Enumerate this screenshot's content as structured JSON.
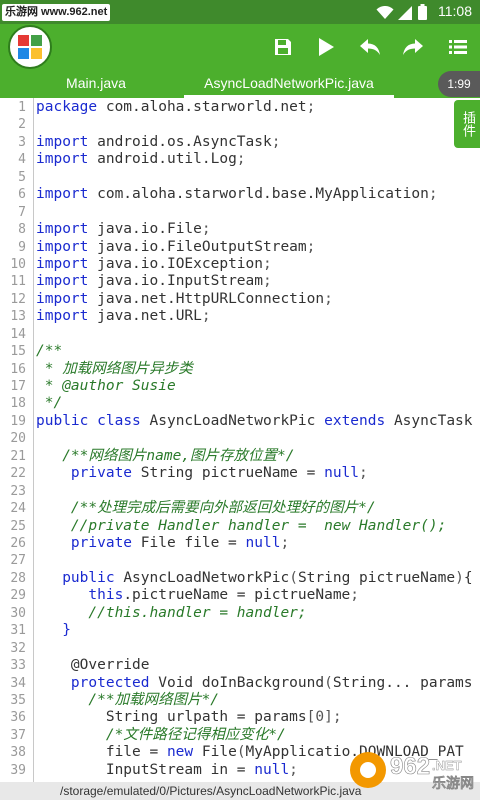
{
  "status_bar": {
    "watermark_text": "乐游网 www.962.net",
    "time": "11:08",
    "icons": [
      "wifi-icon",
      "signal-icon",
      "battery-icon"
    ]
  },
  "toolbar": {
    "logo_icon": "app-grid-logo-icon",
    "buttons": [
      "save-icon",
      "run-icon",
      "undo-icon",
      "redo-icon",
      "menu-list-icon"
    ]
  },
  "tabs": [
    {
      "label": "Main.java",
      "active": false
    },
    {
      "label": "AsyncLoadNetworkPic.java",
      "active": true
    }
  ],
  "tab_badge": "1:99",
  "plugin_tab": "插件",
  "colors": {
    "brand": "#4caf2d",
    "keyword": "#1a2ad0",
    "comment": "#2a7a2a"
  },
  "editor": {
    "lines": [
      {
        "n": "1",
        "t": [
          [
            "kw",
            "package"
          ],
          [
            "pl",
            " com.aloha.starworld.net"
          ],
          [
            "pu",
            ";"
          ]
        ]
      },
      {
        "n": "2",
        "t": []
      },
      {
        "n": "3",
        "t": [
          [
            "kw",
            "import"
          ],
          [
            "pl",
            " android.os.AsyncTask"
          ],
          [
            "pu",
            ";"
          ]
        ]
      },
      {
        "n": "4",
        "t": [
          [
            "kw",
            "import"
          ],
          [
            "pl",
            " android.util.Log"
          ],
          [
            "pu",
            ";"
          ]
        ]
      },
      {
        "n": "5",
        "t": []
      },
      {
        "n": "6",
        "t": [
          [
            "kw",
            "import"
          ],
          [
            "pl",
            " com.aloha.starworld.base.MyApplication"
          ],
          [
            "pu",
            ";"
          ]
        ]
      },
      {
        "n": "7",
        "t": []
      },
      {
        "n": "8",
        "t": [
          [
            "kw",
            "import"
          ],
          [
            "pl",
            " java.io.File"
          ],
          [
            "pu",
            ";"
          ]
        ]
      },
      {
        "n": "9",
        "t": [
          [
            "kw",
            "import"
          ],
          [
            "pl",
            " java.io.FileOutputStream"
          ],
          [
            "pu",
            ";"
          ]
        ]
      },
      {
        "n": "10",
        "t": [
          [
            "kw",
            "import"
          ],
          [
            "pl",
            " java.io.IOException"
          ],
          [
            "pu",
            ";"
          ]
        ]
      },
      {
        "n": "11",
        "t": [
          [
            "kw",
            "import"
          ],
          [
            "pl",
            " java.io.InputStream"
          ],
          [
            "pu",
            ";"
          ]
        ]
      },
      {
        "n": "12",
        "t": [
          [
            "kw",
            "import"
          ],
          [
            "pl",
            " java.net.HttpURLConnection"
          ],
          [
            "pu",
            ";"
          ]
        ]
      },
      {
        "n": "13",
        "t": [
          [
            "kw",
            "import"
          ],
          [
            "pl",
            " java.net.URL"
          ],
          [
            "pu",
            ";"
          ]
        ]
      },
      {
        "n": "14",
        "t": []
      },
      {
        "n": "15",
        "t": [
          [
            "cm",
            "/**"
          ]
        ]
      },
      {
        "n": "16",
        "t": [
          [
            "cm",
            " * 加载网络图片异步类"
          ]
        ]
      },
      {
        "n": "17",
        "t": [
          [
            "cm",
            " * @author Susie"
          ]
        ]
      },
      {
        "n": "18",
        "t": [
          [
            "cm",
            " */"
          ]
        ]
      },
      {
        "n": "19",
        "t": [
          [
            "kw",
            "public"
          ],
          [
            "pl",
            " "
          ],
          [
            "kw",
            "class"
          ],
          [
            "pl",
            " AsyncLoadNetworkPic "
          ],
          [
            "kw",
            "extends"
          ],
          [
            "pl",
            " AsyncTask"
          ]
        ]
      },
      {
        "n": "20",
        "t": []
      },
      {
        "n": "21",
        "t": [
          [
            "pl",
            "   "
          ],
          [
            "cm",
            "/**网络图片name,图片存放位置*/"
          ]
        ]
      },
      {
        "n": "22",
        "t": [
          [
            "pl",
            "    "
          ],
          [
            "kw",
            "private"
          ],
          [
            "pl",
            " String pictrueName = "
          ],
          [
            "kw",
            "null"
          ],
          [
            "pu",
            ";"
          ]
        ]
      },
      {
        "n": "23",
        "t": []
      },
      {
        "n": "24",
        "t": [
          [
            "pl",
            "    "
          ],
          [
            "cm",
            "/**处理完成后需要向外部返回处理好的图片*/"
          ]
        ]
      },
      {
        "n": "25",
        "t": [
          [
            "pl",
            "    "
          ],
          [
            "cm",
            "//private Handler handler =  new Handler();"
          ]
        ]
      },
      {
        "n": "26",
        "t": [
          [
            "pl",
            "    "
          ],
          [
            "kw",
            "private"
          ],
          [
            "pl",
            " File file = "
          ],
          [
            "kw",
            "null"
          ],
          [
            "pu",
            ";"
          ]
        ]
      },
      {
        "n": "27",
        "t": []
      },
      {
        "n": "28",
        "t": [
          [
            "pl",
            "   "
          ],
          [
            "kw",
            "public"
          ],
          [
            "pl",
            " AsyncLoadNetworkPic"
          ],
          [
            "pu",
            "("
          ],
          [
            "pl",
            "String pictrueName"
          ],
          [
            "pu",
            ")"
          ],
          [
            "pl",
            "{"
          ]
        ]
      },
      {
        "n": "29",
        "t": [
          [
            "pl",
            "      "
          ],
          [
            "kw",
            "this"
          ],
          [
            "pl",
            ".pictrueName = pictrueName"
          ],
          [
            "pu",
            ";"
          ]
        ]
      },
      {
        "n": "30",
        "t": [
          [
            "pl",
            "      "
          ],
          [
            "cm",
            "//this.handler = handler;"
          ]
        ]
      },
      {
        "n": "31",
        "t": [
          [
            "pl",
            "   "
          ],
          [
            "kw",
            "}"
          ]
        ]
      },
      {
        "n": "32",
        "t": []
      },
      {
        "n": "33",
        "t": [
          [
            "pl",
            "    @Override"
          ]
        ]
      },
      {
        "n": "34",
        "t": [
          [
            "pl",
            "    "
          ],
          [
            "kw",
            "protected"
          ],
          [
            "pl",
            " Void doInBackground"
          ],
          [
            "pu",
            "("
          ],
          [
            "pl",
            "String... params"
          ]
        ]
      },
      {
        "n": "35",
        "t": [
          [
            "pl",
            "      "
          ],
          [
            "cm",
            "/**加载网络图片*/"
          ]
        ]
      },
      {
        "n": "36",
        "t": [
          [
            "pl",
            "        String urlpath = params"
          ],
          [
            "pu",
            "[0]"
          ],
          [
            "pu",
            ";"
          ]
        ]
      },
      {
        "n": "37",
        "t": [
          [
            "pl",
            "        "
          ],
          [
            "cm",
            "/*文件路径记得相应变化*/"
          ]
        ]
      },
      {
        "n": "38",
        "t": [
          [
            "pl",
            "        file = "
          ],
          [
            "kw",
            "new"
          ],
          [
            "pl",
            " File"
          ],
          [
            "pu",
            "("
          ],
          [
            "pl",
            "MyApplicatio.DOWNLOAD_PAT"
          ]
        ]
      },
      {
        "n": "39",
        "t": [
          [
            "pl",
            "        InputStream in = "
          ],
          [
            "kw",
            "null"
          ],
          [
            "pu",
            ";"
          ]
        ]
      }
    ]
  },
  "footer": {
    "path": "/storage/emulated/0/Pictures/AsyncLoadNetworkPic.java"
  },
  "bottom_watermark": {
    "brand": "962",
    "suffix": ".NET",
    "chinese": "乐游网"
  }
}
